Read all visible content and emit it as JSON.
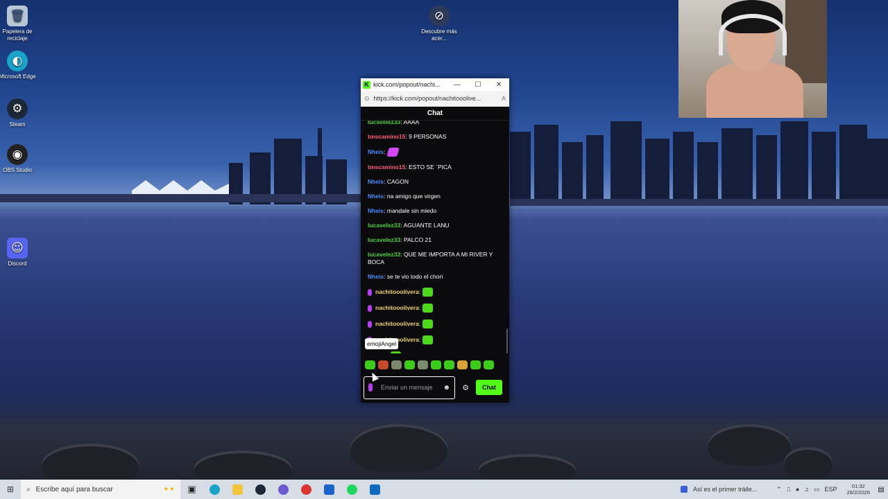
{
  "desktop": {
    "icons": [
      {
        "label": "Papelera de reciclaje",
        "icon": "recycle-bin-icon",
        "glyph": "🗑",
        "color": "#dfe7ef"
      },
      {
        "label": "Microsoft Edge",
        "icon": "edge-icon",
        "glyph": "◐",
        "color": "#1aa3c9"
      },
      {
        "label": "Steam",
        "icon": "steam-icon",
        "glyph": "⚙",
        "color": "#1b2838"
      },
      {
        "label": "OBS Studio",
        "icon": "obs-icon",
        "glyph": "◉",
        "color": "#222"
      },
      {
        "label": "Discord",
        "icon": "discord-icon",
        "glyph": "☺",
        "color": "#5865f2"
      },
      {
        "label": "Descubre más acer...",
        "icon": "discover-icon",
        "glyph": "⊘",
        "color": "#2d3a5a"
      }
    ]
  },
  "browser": {
    "tab_title": "kick.com/popout/nachi...",
    "url": "https://kick.com/popout/nachitooolive...",
    "reader_label": "A",
    "minimize": "—",
    "maximize": "☐",
    "close": "✕"
  },
  "chat": {
    "header": "Chat",
    "messages": [
      {
        "user": "lucavelez33",
        "color": "#4cd137",
        "text": ": AAAA",
        "emote": ""
      },
      {
        "user": "tmscamino15",
        "color": "#ff5c7a",
        "text": ": 9 PERSONAS",
        "emote": ""
      },
      {
        "user": "Nheis",
        "color": "#4a8cff",
        "text": ":",
        "emote": "pink"
      },
      {
        "user": "tmscamino15",
        "color": "#ff5c7a",
        "text": ": ESTO SE ´PICA",
        "emote": ""
      },
      {
        "user": "Nheis",
        "color": "#4a8cff",
        "text": ": CAGON",
        "emote": ""
      },
      {
        "user": "Nheis",
        "color": "#4a8cff",
        "text": ": na amigo que virgen",
        "emote": ""
      },
      {
        "user": "Nheis",
        "color": "#4a8cff",
        "text": ": mandale sin miedo",
        "emote": ""
      },
      {
        "user": "lucavelez33",
        "color": "#4cd137",
        "text": ": AGUANTE LANU",
        "emote": ""
      },
      {
        "user": "lucavelez33",
        "color": "#4cd137",
        "text": ": PALCO 21",
        "emote": ""
      },
      {
        "user": "lucavelez33",
        "color": "#4cd137",
        "text": ": QUE ME IMPORTA A MI RIVER Y BOCA",
        "emote": ""
      },
      {
        "user": "Nheis",
        "color": "#4a8cff",
        "text": ": se te vio todo el chori",
        "emote": ""
      },
      {
        "user": "nachitooolivera",
        "color": "#f3d36b",
        "text": ":",
        "emote": "green",
        "mic": true
      },
      {
        "user": "nachitooolivera",
        "color": "#f3d36b",
        "text": ":",
        "emote": "green",
        "mic": true
      },
      {
        "user": "nachitooolivera",
        "color": "#f3d36b",
        "text": ":",
        "emote": "green",
        "mic": true
      },
      {
        "user": "nachitooolivera",
        "color": "#f3d36b",
        "text": ":",
        "emote": "green",
        "mic": true
      },
      {
        "user": "olivera",
        "color": "#f3d36b",
        "text": ":",
        "emote": "green",
        "mic": false
      }
    ],
    "tooltip": "emojiAngel",
    "input_placeholder": "Enviar un mensaje",
    "send_label": "Chat",
    "accent": "#53fc18"
  },
  "taskbar": {
    "search_placeholder": "Escribe aquí para buscar",
    "media_title": "Así es el primer tráile...",
    "language": "ESP",
    "time": "01:32",
    "date": "28/2/2026"
  }
}
